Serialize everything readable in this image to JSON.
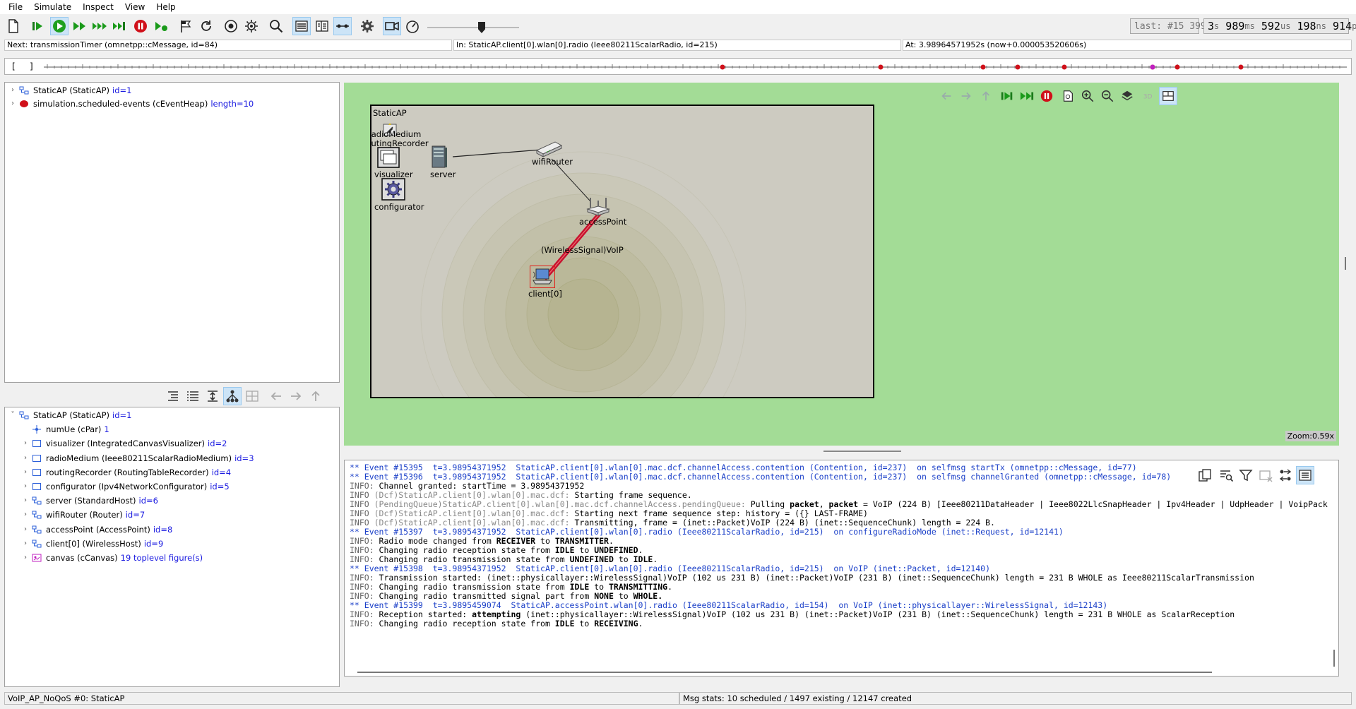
{
  "menu": [
    "File",
    "Simulate",
    "Inspect",
    "View",
    "Help"
  ],
  "toolbar": {
    "icons": [
      "new-file-icon",
      "step-icon",
      "run-icon",
      "fast-run-icon",
      "express-run-icon",
      "run-until-icon",
      "stop-icon",
      "debug-next-icon",
      "rebuild-network-icon",
      "restart-icon",
      "record-icon",
      "preferences-icon",
      "find-icon",
      "inspector-list-icon",
      "split-view-icon",
      "link-icon",
      "settings-icon",
      "video-icon",
      "animation-speed-icon"
    ],
    "last_event": "last: #15 399",
    "sim_time": {
      "s": "3",
      "ms": "989",
      "us": "592",
      "ns": "198",
      "ps": "914",
      "u_s": "s",
      "u_ms": "ms",
      "u_us": "us",
      "u_ns": "ns",
      "u_ps": "ps"
    }
  },
  "statusbar": {
    "next": "Next: transmissionTimer (omnetpp::cMessage, id=84)",
    "in": "In: StaticAP.client[0].wlan[0].radio (Ieee80211ScalarRadio, id=215)",
    "at": "At: 3.98964571952s (now+0.000053520606s)"
  },
  "timeline": {
    "bracket_open": "[",
    "bracket_close": "]"
  },
  "object_tree_top": [
    {
      "name": "StaticAP (StaticAP)",
      "id": "id=1"
    },
    {
      "name": "simulation.scheduled-events (cEventHeap)",
      "id": "length=10"
    }
  ],
  "module_tree": [
    {
      "name": "StaticAP (StaticAP)",
      "id": "id=1",
      "level": 0,
      "arrow": "˅"
    },
    {
      "name": "numUe (cPar)",
      "id": "1",
      "level": 1,
      "arrow": ""
    },
    {
      "name": "visualizer (IntegratedCanvasVisualizer)",
      "id": "id=2",
      "level": 1,
      "arrow": "›"
    },
    {
      "name": "radioMedium (Ieee80211ScalarRadioMedium)",
      "id": "id=3",
      "level": 1,
      "arrow": "›"
    },
    {
      "name": "routingRecorder (RoutingTableRecorder)",
      "id": "id=4",
      "level": 1,
      "arrow": "›"
    },
    {
      "name": "configurator (Ipv4NetworkConfigurator)",
      "id": "id=5",
      "level": 1,
      "arrow": "›"
    },
    {
      "name": "server (StandardHost)",
      "id": "id=6",
      "level": 1,
      "arrow": "›"
    },
    {
      "name": "wifiRouter (Router)",
      "id": "id=7",
      "level": 1,
      "arrow": "›"
    },
    {
      "name": "accessPoint (AccessPoint)",
      "id": "id=8",
      "level": 1,
      "arrow": "›"
    },
    {
      "name": "client[0] (WirelessHost)",
      "id": "id=9",
      "level": 1,
      "arrow": "›"
    },
    {
      "name": "canvas (cCanvas)",
      "id": "19 toplevel figure(s)",
      "level": 1,
      "arrow": "›"
    }
  ],
  "network": {
    "title": "StaticAP",
    "radio_medium": "radioMedium",
    "routing_recorder": "routingRecorder",
    "visualizer": "visualizer",
    "configurator": "configurator",
    "server": "server",
    "wifi_router": "wifiRouter",
    "access_point": "accessPoint",
    "client": "client[0]",
    "signal": "(WirelessSignal)VoIP",
    "zoom": "Zoom:0.59x"
  },
  "log": [
    {
      "kind": "event",
      "text": "** Event #15395  t=3.98954371952  StaticAP.client[0].wlan[0].mac.dcf.channelAccess.contention (Contention, id=237)  on selfmsg startTx (omnetpp::cMessage, id=77)"
    },
    {
      "kind": "event",
      "text": "** Event #15396  t=3.98954371952  StaticAP.client[0].wlan[0].mac.dcf.channelAccess.contention (Contention, id=237)  on selfmsg channelGranted (omnetpp::cMessage, id=78)"
    },
    {
      "kind": "info",
      "pre": "INFO: ",
      "ctx": "",
      "text": "Channel granted: startTime = 3.98954371952"
    },
    {
      "kind": "info",
      "pre": "INFO ",
      "ctx": "(Dcf)StaticAP.client[0].wlan[0].mac.dcf:",
      "text": " Starting frame sequence."
    },
    {
      "kind": "info",
      "pre": "INFO ",
      "ctx": "(PendingQueue)StaticAP.client[0].wlan[0].mac.dcf.channelAccess.pendingQueue:",
      "text": " Pulling packet, packet = VoIP (224 B) [Ieee80211DataHeader | Ieee8022LlcSnapHeader | Ipv4Header | UdpHeader | VoipPack"
    },
    {
      "kind": "info",
      "pre": "INFO ",
      "ctx": "(Dcf)StaticAP.client[0].wlan[0].mac.dcf:",
      "text": " Starting next frame sequence step: history = ({} LAST-FRAME)"
    },
    {
      "kind": "info",
      "pre": "INFO ",
      "ctx": "(Dcf)StaticAP.client[0].wlan[0].mac.dcf:",
      "text": " Transmitting, frame = (inet::Packet)VoIP (224 B) (inet::SequenceChunk) length = 224 B."
    },
    {
      "kind": "event",
      "text": "** Event #15397  t=3.98954371952  StaticAP.client[0].wlan[0].radio (Ieee80211ScalarRadio, id=215)  on configureRadioMode (inet::Request, id=12141)"
    },
    {
      "kind": "info",
      "pre": "INFO: ",
      "ctx": "",
      "text": "Radio mode changed from RECEIVER to TRANSMITTER."
    },
    {
      "kind": "info",
      "pre": "INFO: ",
      "ctx": "",
      "text": "Changing radio reception state from IDLE to UNDEFINED."
    },
    {
      "kind": "info",
      "pre": "INFO: ",
      "ctx": "",
      "text": "Changing radio transmission state from UNDEFINED to IDLE."
    },
    {
      "kind": "event",
      "text": "** Event #15398  t=3.98954371952  StaticAP.client[0].wlan[0].radio (Ieee80211ScalarRadio, id=215)  on VoIP (inet::Packet, id=12140)"
    },
    {
      "kind": "info",
      "pre": "INFO: ",
      "ctx": "",
      "text": "Transmission started: (inet::physicallayer::WirelessSignal)VoIP (102 us 231 B) (inet::Packet)VoIP (231 B) (inet::SequenceChunk) length = 231 B WHOLE as Ieee80211ScalarTransmission"
    },
    {
      "kind": "info",
      "pre": "INFO: ",
      "ctx": "",
      "text": "Changing radio transmission state from IDLE to TRANSMITTING."
    },
    {
      "kind": "info",
      "pre": "INFO: ",
      "ctx": "",
      "text": "Changing radio transmitted signal part from NONE to WHOLE."
    },
    {
      "kind": "event",
      "text": "** Event #15399  t=3.9895459074  StaticAP.accessPoint.wlan[0].radio (Ieee80211ScalarRadio, id=154)  on VoIP (inet::physicallayer::WirelessSignal, id=12143)"
    },
    {
      "kind": "info",
      "pre": "INFO: ",
      "ctx": "",
      "text": "Reception started: attempting (inet::physicallayer::WirelessSignal)VoIP (102 us 231 B) (inet::Packet)VoIP (231 B) (inet::SequenceChunk) length = 231 B WHOLE as ScalarReception"
    },
    {
      "kind": "info",
      "pre": "INFO: ",
      "ctx": "",
      "text": "Changing radio reception state from IDLE to RECEIVING."
    }
  ],
  "bottom_status": {
    "left": "VoIP_AP_NoQoS #0: StaticAP",
    "right": "Msg stats: 10 scheduled / 1497 existing / 12147 created"
  },
  "colors": {
    "canvas_bg": "#a3dc96",
    "module_bg": "#cdcbc1",
    "signal_line": "#c8102e",
    "timeline_marker": "#d0101a",
    "timeline_marker_special": "#c020c0",
    "log_event": "#1a3fc8",
    "link_blue": "#1a1ae0"
  }
}
